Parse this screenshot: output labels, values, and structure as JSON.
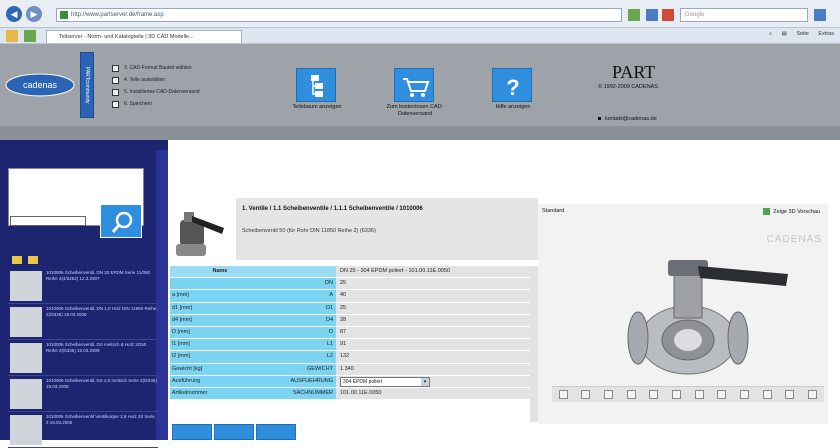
{
  "browser": {
    "url": "http://www.partserver.de/frame.asp",
    "search_placeholder": "Google",
    "tab_title": "Teilserver - Norm- und Katalogteile | 3D CAD Modelle...",
    "toolbar_items": [
      "Seite",
      "Extras"
    ]
  },
  "header": {
    "logo_text": "cadenas",
    "vstrip_text": "PARTcommunity",
    "options": [
      "3. CAD-Format Bauteil wählen",
      "4. Teile auswählen",
      "5. Installiertes CAD-Datenversand",
      "6. Speichern"
    ],
    "buttons": [
      {
        "label": "Teilebaum anzeigen"
      },
      {
        "label": "Zum kostenlosen CAD-Datenversand"
      },
      {
        "label": "Hilfe anzeigen"
      }
    ],
    "part_logo": "PART",
    "copyright": "© 1992-2009 CADENAS",
    "email": "kontakt@cadenas.de"
  },
  "sidebar": {
    "items": [
      {
        "text": "1010006 Scheibenventil, DN 20 EPDM Serie 11/050 Reihe 2(4/6252) 12.3.2007"
      },
      {
        "text": "1010006 Scheibenventil, DN 1,0 Holz DIN 11850 Reihe 2(/6336) 19.03.2009"
      },
      {
        "text": "1010006 Scheibenventil, DS meltsch & Holz 2G50 Reihe 2(/6336) 19.03.2009"
      },
      {
        "text": "1010006 Scheibenventil, DS 2,0 meltsch Serie 2(/6336) 19.03.2009"
      },
      {
        "text": "1010006 Scheibenventil Ventilkorper 2,8 Holz 20 Serie 2 19.03.2009"
      }
    ]
  },
  "product": {
    "breadcrumb": "1. Ventile / 1.1 Scheibenventile / 1.1.1 Scheibenventile / 1010006",
    "description": "Scheibenventil 50 (für Rohr DIN 11850 Reihe 2) (6336)"
  },
  "table": {
    "header": {
      "c1": "Name",
      "c2": "",
      "c3": "DN 25 - 304 EPDM poliert - 101.00.11E.0050"
    },
    "rows": [
      {
        "c1": "",
        "c2": "DN",
        "c3": "25"
      },
      {
        "c1": "a [mm]",
        "c2": "A",
        "c3": "40"
      },
      {
        "c1": "d1 [mm]",
        "c2": "D1",
        "c3": "25"
      },
      {
        "c1": "d4 [mm]",
        "c2": "D4",
        "c3": "28"
      },
      {
        "c1": "D [mm]",
        "c2": "D",
        "c3": "87"
      },
      {
        "c1": "l1 [mm]",
        "c2": "L1",
        "c3": "91"
      },
      {
        "c1": "l2 [mm]",
        "c2": "L2",
        "c3": "132"
      },
      {
        "c1": "Gewicht [kg]",
        "c2": "GEWICHT",
        "c3": "1.340"
      },
      {
        "c1": "Ausführung",
        "c2": "AUSFUEHRUNG",
        "c3": "",
        "select": "304 EPDM poliert"
      },
      {
        "c1": "Artikelnummer",
        "c2": "SACHNUMMER",
        "c3": "101.00.11E.0050"
      }
    ]
  },
  "viewer": {
    "label": "Standard",
    "checkbox_label": "Zeige 3D Vorschau",
    "brand": "CADENAS"
  },
  "colors": {
    "header_bg": "#9da3a9",
    "sidebar_bg": "#1d2470",
    "button_blue": "#2f8fde",
    "table_cyan": "#7bd4f2"
  }
}
